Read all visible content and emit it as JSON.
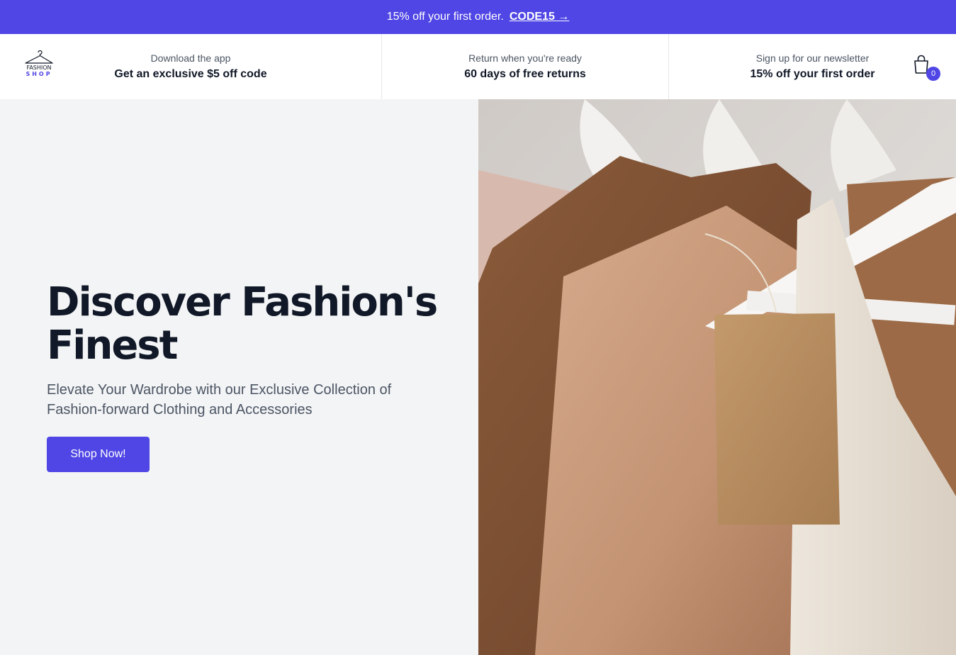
{
  "announcement": {
    "text": "15% off your first order.",
    "code_link": "CODE15 →"
  },
  "logo": {
    "line1": "FASHION",
    "line2": "SHOP"
  },
  "perks": [
    {
      "sub": "Download the app",
      "main": "Get an exclusive $5 off code"
    },
    {
      "sub": "Return when you're ready",
      "main": "60 days of free returns"
    },
    {
      "sub": "Sign up for our newsletter",
      "main": "15% off your first order"
    }
  ],
  "cart": {
    "icon": "shopping-bag-icon",
    "count": "0"
  },
  "hero": {
    "title": "Discover Fashion's Finest",
    "subtitle": "Elevate Your Wardrobe with our Exclusive Collection of Fashion-forward Clothing and Accessories",
    "button_label": "Shop Now!"
  },
  "colors": {
    "accent": "#4f46e5",
    "hero_bg": "#f3f4f6",
    "title_text": "#111827"
  }
}
